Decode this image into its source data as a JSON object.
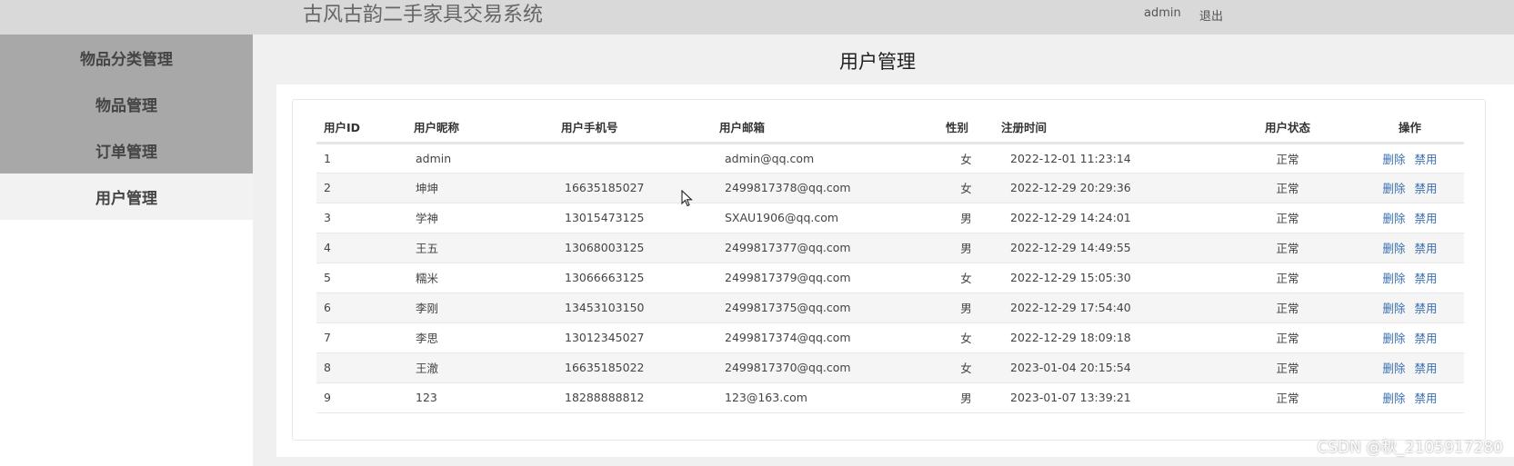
{
  "header": {
    "app_title": "古风古韵二手家具交易系统",
    "user": "admin",
    "logout": "退出"
  },
  "sidebar": {
    "items": [
      {
        "label": "物品分类管理",
        "active": false
      },
      {
        "label": "物品管理",
        "active": false
      },
      {
        "label": "订单管理",
        "active": false
      },
      {
        "label": "用户管理",
        "active": true
      }
    ]
  },
  "page": {
    "title": "用户管理"
  },
  "table": {
    "columns": [
      "用户ID",
      "用户昵称",
      "用户手机号",
      "用户邮箱",
      "性别",
      "注册时间",
      "用户状态",
      "操作"
    ],
    "delete_label": "删除",
    "disable_label": "禁用",
    "rows": [
      {
        "id": "1",
        "nick": "admin",
        "phone": "",
        "email": "admin@qq.com",
        "sex": "女",
        "time": "2022-12-01 11:23:14",
        "status": "正常"
      },
      {
        "id": "2",
        "nick": "坤坤",
        "phone": "16635185027",
        "email": "2499817378@qq.com",
        "sex": "女",
        "time": "2022-12-29 20:29:36",
        "status": "正常"
      },
      {
        "id": "3",
        "nick": "学神",
        "phone": "13015473125",
        "email": "SXAU1906@qq.com",
        "sex": "男",
        "time": "2022-12-29 14:24:01",
        "status": "正常"
      },
      {
        "id": "4",
        "nick": "王五",
        "phone": "13068003125",
        "email": "2499817377@qq.com",
        "sex": "男",
        "time": "2022-12-29 14:49:55",
        "status": "正常"
      },
      {
        "id": "5",
        "nick": "糯米",
        "phone": "13066663125",
        "email": "2499817379@qq.com",
        "sex": "女",
        "time": "2022-12-29 15:05:30",
        "status": "正常"
      },
      {
        "id": "6",
        "nick": "李刚",
        "phone": "13453103150",
        "email": "2499817375@qq.com",
        "sex": "男",
        "time": "2022-12-29 17:54:40",
        "status": "正常"
      },
      {
        "id": "7",
        "nick": "李思",
        "phone": "13012345027",
        "email": "2499817374@qq.com",
        "sex": "女",
        "time": "2022-12-29 18:09:18",
        "status": "正常"
      },
      {
        "id": "8",
        "nick": "王澈",
        "phone": "16635185022",
        "email": "2499817370@qq.com",
        "sex": "女",
        "time": "2023-01-04 20:15:54",
        "status": "正常"
      },
      {
        "id": "9",
        "nick": "123",
        "phone": "18288888812",
        "email": "123@163.com",
        "sex": "男",
        "time": "2023-01-07 13:39:21",
        "status": "正常"
      }
    ]
  },
  "watermark": "CSDN @秋_2105917280"
}
